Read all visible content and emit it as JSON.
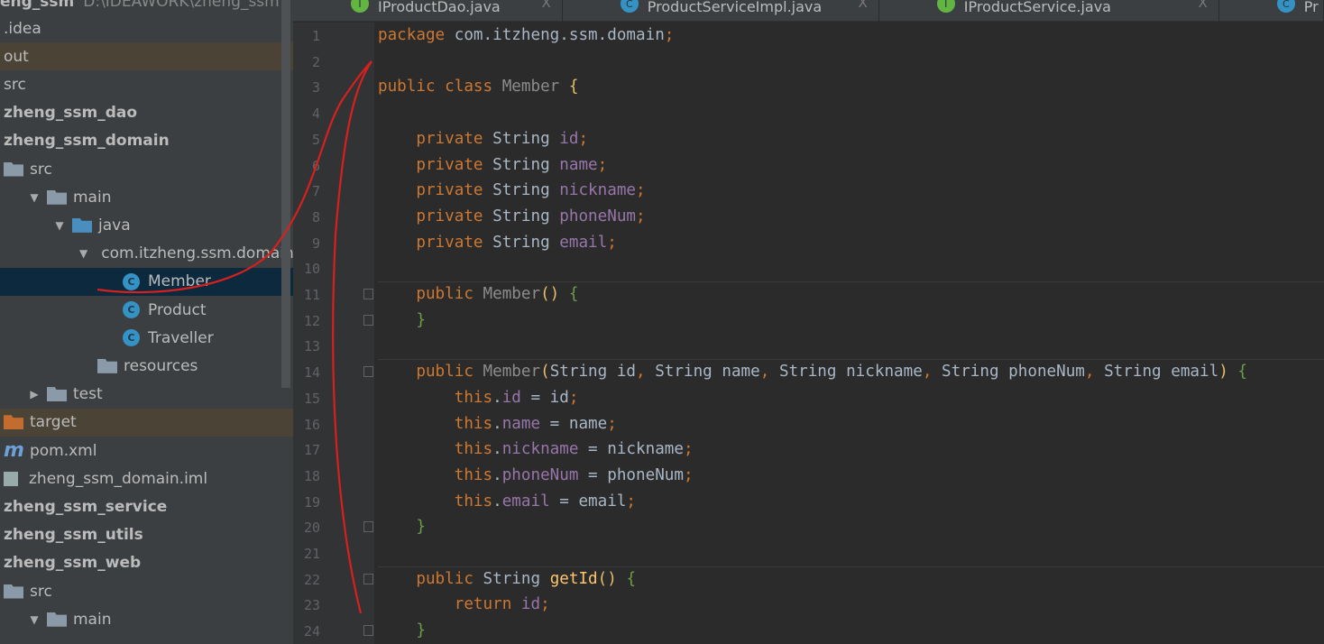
{
  "project": {
    "name": "zheng_ssm",
    "path": "D:\\IDEAWORK\\zheng_ssm"
  },
  "tree": [
    {
      "label": ".idea",
      "depth": 0,
      "icon": "none",
      "style": ""
    },
    {
      "label": "out",
      "depth": 0,
      "icon": "none",
      "style": "ex"
    },
    {
      "label": "src",
      "depth": 0,
      "icon": "none",
      "style": ""
    },
    {
      "label": "zheng_ssm_dao",
      "depth": 0,
      "icon": "none",
      "style": "bold"
    },
    {
      "label": "zheng_ssm_domain",
      "depth": 0,
      "icon": "none",
      "style": "bold"
    },
    {
      "label": "src",
      "depth": 0,
      "icon": "folder",
      "style": ""
    },
    {
      "label": "main",
      "depth": 1,
      "icon": "folder",
      "arrow": "▼",
      "style": ""
    },
    {
      "label": "java",
      "depth": 2,
      "icon": "folder-blue",
      "arrow": "▼",
      "style": ""
    },
    {
      "label": "com.itzheng.ssm.domain",
      "depth": 3,
      "icon": "package",
      "arrow": "▼",
      "style": ""
    },
    {
      "label": "Member",
      "depth": 4,
      "icon": "class",
      "style": "sel"
    },
    {
      "label": "Product",
      "depth": 4,
      "icon": "class",
      "style": ""
    },
    {
      "label": "Traveller",
      "depth": 4,
      "icon": "class",
      "style": ""
    },
    {
      "label": "resources",
      "depth": 3,
      "icon": "folder-res",
      "style": ""
    },
    {
      "label": "test",
      "depth": 1,
      "icon": "folder",
      "arrow": "▶",
      "style": ""
    },
    {
      "label": "target",
      "depth": 0,
      "icon": "folder-orange",
      "style": "ex"
    },
    {
      "label": "pom.xml",
      "depth": 0,
      "icon": "maven",
      "style": ""
    },
    {
      "label": "zheng_ssm_domain.iml",
      "depth": 0,
      "icon": "iml",
      "style": ""
    },
    {
      "label": "zheng_ssm_service",
      "depth": 0,
      "icon": "none",
      "style": "bold"
    },
    {
      "label": "zheng_ssm_utils",
      "depth": 0,
      "icon": "none",
      "style": "bold"
    },
    {
      "label": "zheng_ssm_web",
      "depth": 0,
      "icon": "none",
      "style": "bold"
    },
    {
      "label": "src",
      "depth": 0,
      "icon": "folder",
      "style": ""
    },
    {
      "label": "main",
      "depth": 1,
      "icon": "folder",
      "arrow": "▼",
      "style": ""
    }
  ],
  "tabs": [
    {
      "label": "IProductDao.java",
      "icon": "interface-icon",
      "color": "#62b543",
      "letter": "I",
      "close": "X"
    },
    {
      "label": "ProductServiceImpl.java",
      "icon": "class-icon",
      "color": "#3592c4",
      "letter": "C",
      "close": "X"
    },
    {
      "label": "IProductService.java",
      "icon": "interface-icon",
      "color": "#62b543",
      "letter": "I",
      "close": "X"
    },
    {
      "label": "Pr",
      "icon": "class-icon",
      "color": "#3592c4",
      "letter": "C",
      "close": ""
    }
  ],
  "colors": {
    "keyword": "#cc7832",
    "field": "#9876aa",
    "method": "#ffc66d",
    "annotation_stroke": "#d8201e"
  },
  "code": [
    [
      [
        "package",
        "kw"
      ],
      [
        " com.itzheng.ssm.domain",
        "pl"
      ],
      [
        ";",
        "kw"
      ]
    ],
    [],
    [
      [
        "public class ",
        "kw"
      ],
      [
        "Member ",
        "cn"
      ],
      [
        "{",
        "br1"
      ]
    ],
    [],
    [
      [
        "    private ",
        "kw"
      ],
      [
        "String ",
        "pl"
      ],
      [
        "id",
        "fd"
      ],
      [
        ";",
        "kw"
      ]
    ],
    [
      [
        "    private ",
        "kw"
      ],
      [
        "String ",
        "pl"
      ],
      [
        "name",
        "fd"
      ],
      [
        ";",
        "kw"
      ]
    ],
    [
      [
        "    private ",
        "kw"
      ],
      [
        "String ",
        "pl"
      ],
      [
        "nickname",
        "fd"
      ],
      [
        ";",
        "kw"
      ]
    ],
    [
      [
        "    private ",
        "kw"
      ],
      [
        "String ",
        "pl"
      ],
      [
        "phoneNum",
        "fd"
      ],
      [
        ";",
        "kw"
      ]
    ],
    [
      [
        "    private ",
        "kw"
      ],
      [
        "String ",
        "pl"
      ],
      [
        "email",
        "fd"
      ],
      [
        ";",
        "kw"
      ]
    ],
    [],
    [
      [
        "    public ",
        "kw"
      ],
      [
        "Member",
        "cn"
      ],
      [
        "() ",
        "br1"
      ],
      [
        "{",
        "br2"
      ]
    ],
    [
      [
        "    }",
        "br2"
      ]
    ],
    [],
    [
      [
        "    public ",
        "kw"
      ],
      [
        "Member",
        "cn"
      ],
      [
        "(",
        "br1"
      ],
      [
        "String id",
        "pl"
      ],
      [
        ", ",
        "kw"
      ],
      [
        "String name",
        "pl"
      ],
      [
        ", ",
        "kw"
      ],
      [
        "String nickname",
        "pl"
      ],
      [
        ", ",
        "kw"
      ],
      [
        "String phoneNum",
        "pl"
      ],
      [
        ", ",
        "kw"
      ],
      [
        "String email",
        "pl"
      ],
      [
        ") ",
        "br1"
      ],
      [
        "{",
        "br2"
      ]
    ],
    [
      [
        "        this",
        "kw"
      ],
      [
        ".",
        "pl"
      ],
      [
        "id",
        "fd"
      ],
      [
        " = id",
        "pl"
      ],
      [
        ";",
        "kw"
      ]
    ],
    [
      [
        "        this",
        "kw"
      ],
      [
        ".",
        "pl"
      ],
      [
        "name",
        "fd"
      ],
      [
        " = name",
        "pl"
      ],
      [
        ";",
        "kw"
      ]
    ],
    [
      [
        "        this",
        "kw"
      ],
      [
        ".",
        "pl"
      ],
      [
        "nickname",
        "fd"
      ],
      [
        " = nickname",
        "pl"
      ],
      [
        ";",
        "kw"
      ]
    ],
    [
      [
        "        this",
        "kw"
      ],
      [
        ".",
        "pl"
      ],
      [
        "phoneNum",
        "fd"
      ],
      [
        " = phoneNum",
        "pl"
      ],
      [
        ";",
        "kw"
      ]
    ],
    [
      [
        "        this",
        "kw"
      ],
      [
        ".",
        "pl"
      ],
      [
        "email",
        "fd"
      ],
      [
        " = email",
        "pl"
      ],
      [
        ";",
        "kw"
      ]
    ],
    [
      [
        "    }",
        "br2"
      ]
    ],
    [],
    [
      [
        "    public ",
        "kw"
      ],
      [
        "String ",
        "pl"
      ],
      [
        "getId",
        "mt"
      ],
      [
        "() ",
        "br1"
      ],
      [
        "{",
        "br2"
      ]
    ],
    [
      [
        "        return ",
        "kw"
      ],
      [
        "id",
        "fd"
      ],
      [
        ";",
        "kw"
      ]
    ],
    [
      [
        "    }",
        "br2"
      ]
    ]
  ]
}
